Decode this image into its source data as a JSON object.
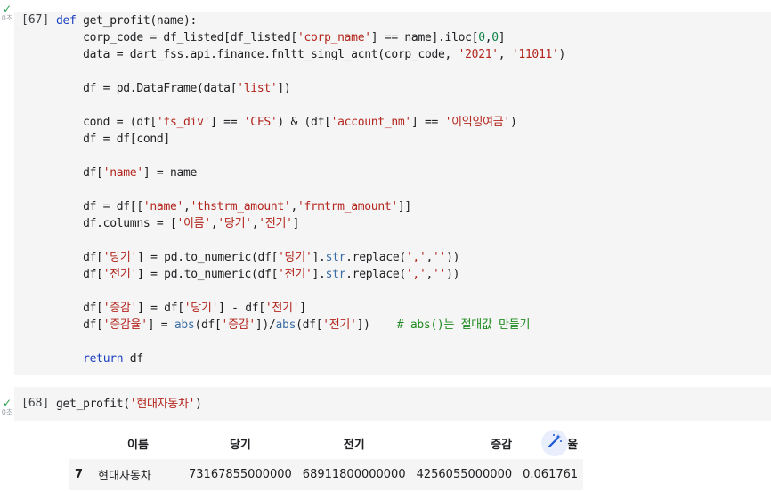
{
  "cells": [
    {
      "exec_count": "[67]",
      "status_duration": "0초",
      "code_lines": [
        [
          {
            "t": "def",
            "c": "kw"
          },
          {
            "t": " get_profit(name):"
          }
        ],
        [
          {
            "t": "    corp_code = df_listed[df_listed["
          },
          {
            "t": "'corp_name'",
            "c": "str"
          },
          {
            "t": "] == name].iloc["
          },
          {
            "t": "0",
            "c": "num"
          },
          {
            "t": ","
          },
          {
            "t": "0",
            "c": "num"
          },
          {
            "t": "]"
          }
        ],
        [
          {
            "t": "    data = dart_fss.api.finance.fnltt_singl_acnt(corp_code, "
          },
          {
            "t": "'2021'",
            "c": "str"
          },
          {
            "t": ", "
          },
          {
            "t": "'11011'",
            "c": "str"
          },
          {
            "t": ")"
          }
        ],
        [],
        [
          {
            "t": "    df = pd.DataFrame(data["
          },
          {
            "t": "'list'",
            "c": "str"
          },
          {
            "t": "])"
          }
        ],
        [],
        [
          {
            "t": "    cond = (df["
          },
          {
            "t": "'fs_div'",
            "c": "str"
          },
          {
            "t": "] == "
          },
          {
            "t": "'CFS'",
            "c": "str"
          },
          {
            "t": ") & (df["
          },
          {
            "t": "'account_nm'",
            "c": "str"
          },
          {
            "t": "] == "
          },
          {
            "t": "'이익잉여금'",
            "c": "str"
          },
          {
            "t": ")"
          }
        ],
        [
          {
            "t": "    df = df[cond]"
          }
        ],
        [],
        [
          {
            "t": "    df["
          },
          {
            "t": "'name'",
            "c": "str"
          },
          {
            "t": "] = name"
          }
        ],
        [],
        [
          {
            "t": "    df = df[["
          },
          {
            "t": "'name'",
            "c": "str"
          },
          {
            "t": ","
          },
          {
            "t": "'thstrm_amount'",
            "c": "str"
          },
          {
            "t": ","
          },
          {
            "t": "'frmtrm_amount'",
            "c": "str"
          },
          {
            "t": "]]"
          }
        ],
        [
          {
            "t": "    df.columns = ["
          },
          {
            "t": "'이름'",
            "c": "str"
          },
          {
            "t": ","
          },
          {
            "t": "'당기'",
            "c": "str"
          },
          {
            "t": ","
          },
          {
            "t": "'전기'",
            "c": "str"
          },
          {
            "t": "]"
          }
        ],
        [],
        [
          {
            "t": "    df["
          },
          {
            "t": "'당기'",
            "c": "str"
          },
          {
            "t": "] = pd.to_numeric(df["
          },
          {
            "t": "'당기'",
            "c": "str"
          },
          {
            "t": "]."
          },
          {
            "t": "str",
            "c": "meth"
          },
          {
            "t": ".replace("
          },
          {
            "t": "','",
            "c": "str"
          },
          {
            "t": ","
          },
          {
            "t": "''",
            "c": "str"
          },
          {
            "t": "))"
          }
        ],
        [
          {
            "t": "    df["
          },
          {
            "t": "'전기'",
            "c": "str"
          },
          {
            "t": "] = pd.to_numeric(df["
          },
          {
            "t": "'전기'",
            "c": "str"
          },
          {
            "t": "]."
          },
          {
            "t": "str",
            "c": "meth"
          },
          {
            "t": ".replace("
          },
          {
            "t": "','",
            "c": "str"
          },
          {
            "t": ","
          },
          {
            "t": "''",
            "c": "str"
          },
          {
            "t": "))"
          }
        ],
        [],
        [
          {
            "t": "    df["
          },
          {
            "t": "'증감'",
            "c": "str"
          },
          {
            "t": "] = df["
          },
          {
            "t": "'당기'",
            "c": "str"
          },
          {
            "t": "] - df["
          },
          {
            "t": "'전기'",
            "c": "str"
          },
          {
            "t": "]"
          }
        ],
        [
          {
            "t": "    df["
          },
          {
            "t": "'증감율'",
            "c": "str"
          },
          {
            "t": "] = "
          },
          {
            "t": "abs",
            "c": "meth"
          },
          {
            "t": "(df["
          },
          {
            "t": "'증감'",
            "c": "str"
          },
          {
            "t": "])/"
          },
          {
            "t": "abs",
            "c": "meth"
          },
          {
            "t": "(df["
          },
          {
            "t": "'전기'",
            "c": "str"
          },
          {
            "t": "])    "
          },
          {
            "t": "# abs()는 절대값 만들기",
            "c": "cmt"
          }
        ],
        [],
        [
          {
            "t": "    "
          },
          {
            "t": "return",
            "c": "kw"
          },
          {
            "t": " df"
          }
        ]
      ]
    },
    {
      "exec_count": "[68]",
      "status_duration": "0초",
      "code_lines": [
        [
          {
            "t": "get_profit("
          },
          {
            "t": "'현대자동차'",
            "c": "str"
          },
          {
            "t": ")"
          }
        ]
      ]
    }
  ],
  "output_table": {
    "columns": [
      "",
      "이름",
      "당기",
      "전기",
      "증감",
      "증감율"
    ],
    "rows": [
      {
        "index": "7",
        "이름": "현대자동차",
        "당기": "73167855000000",
        "전기": "68911800000000",
        "증감": "4256055000000",
        "증감율": "0.061761"
      }
    ]
  },
  "icons": {
    "cell_status": "checkmark-icon",
    "suggest_chart": "magic-wand-icon"
  },
  "colors": {
    "keyword": "#1a3fbf",
    "string": "#b3261e",
    "number": "#0b8043",
    "comment": "#1e8a1e",
    "check": "#2e9f4e",
    "cell_bg": "#f5f5f5"
  }
}
